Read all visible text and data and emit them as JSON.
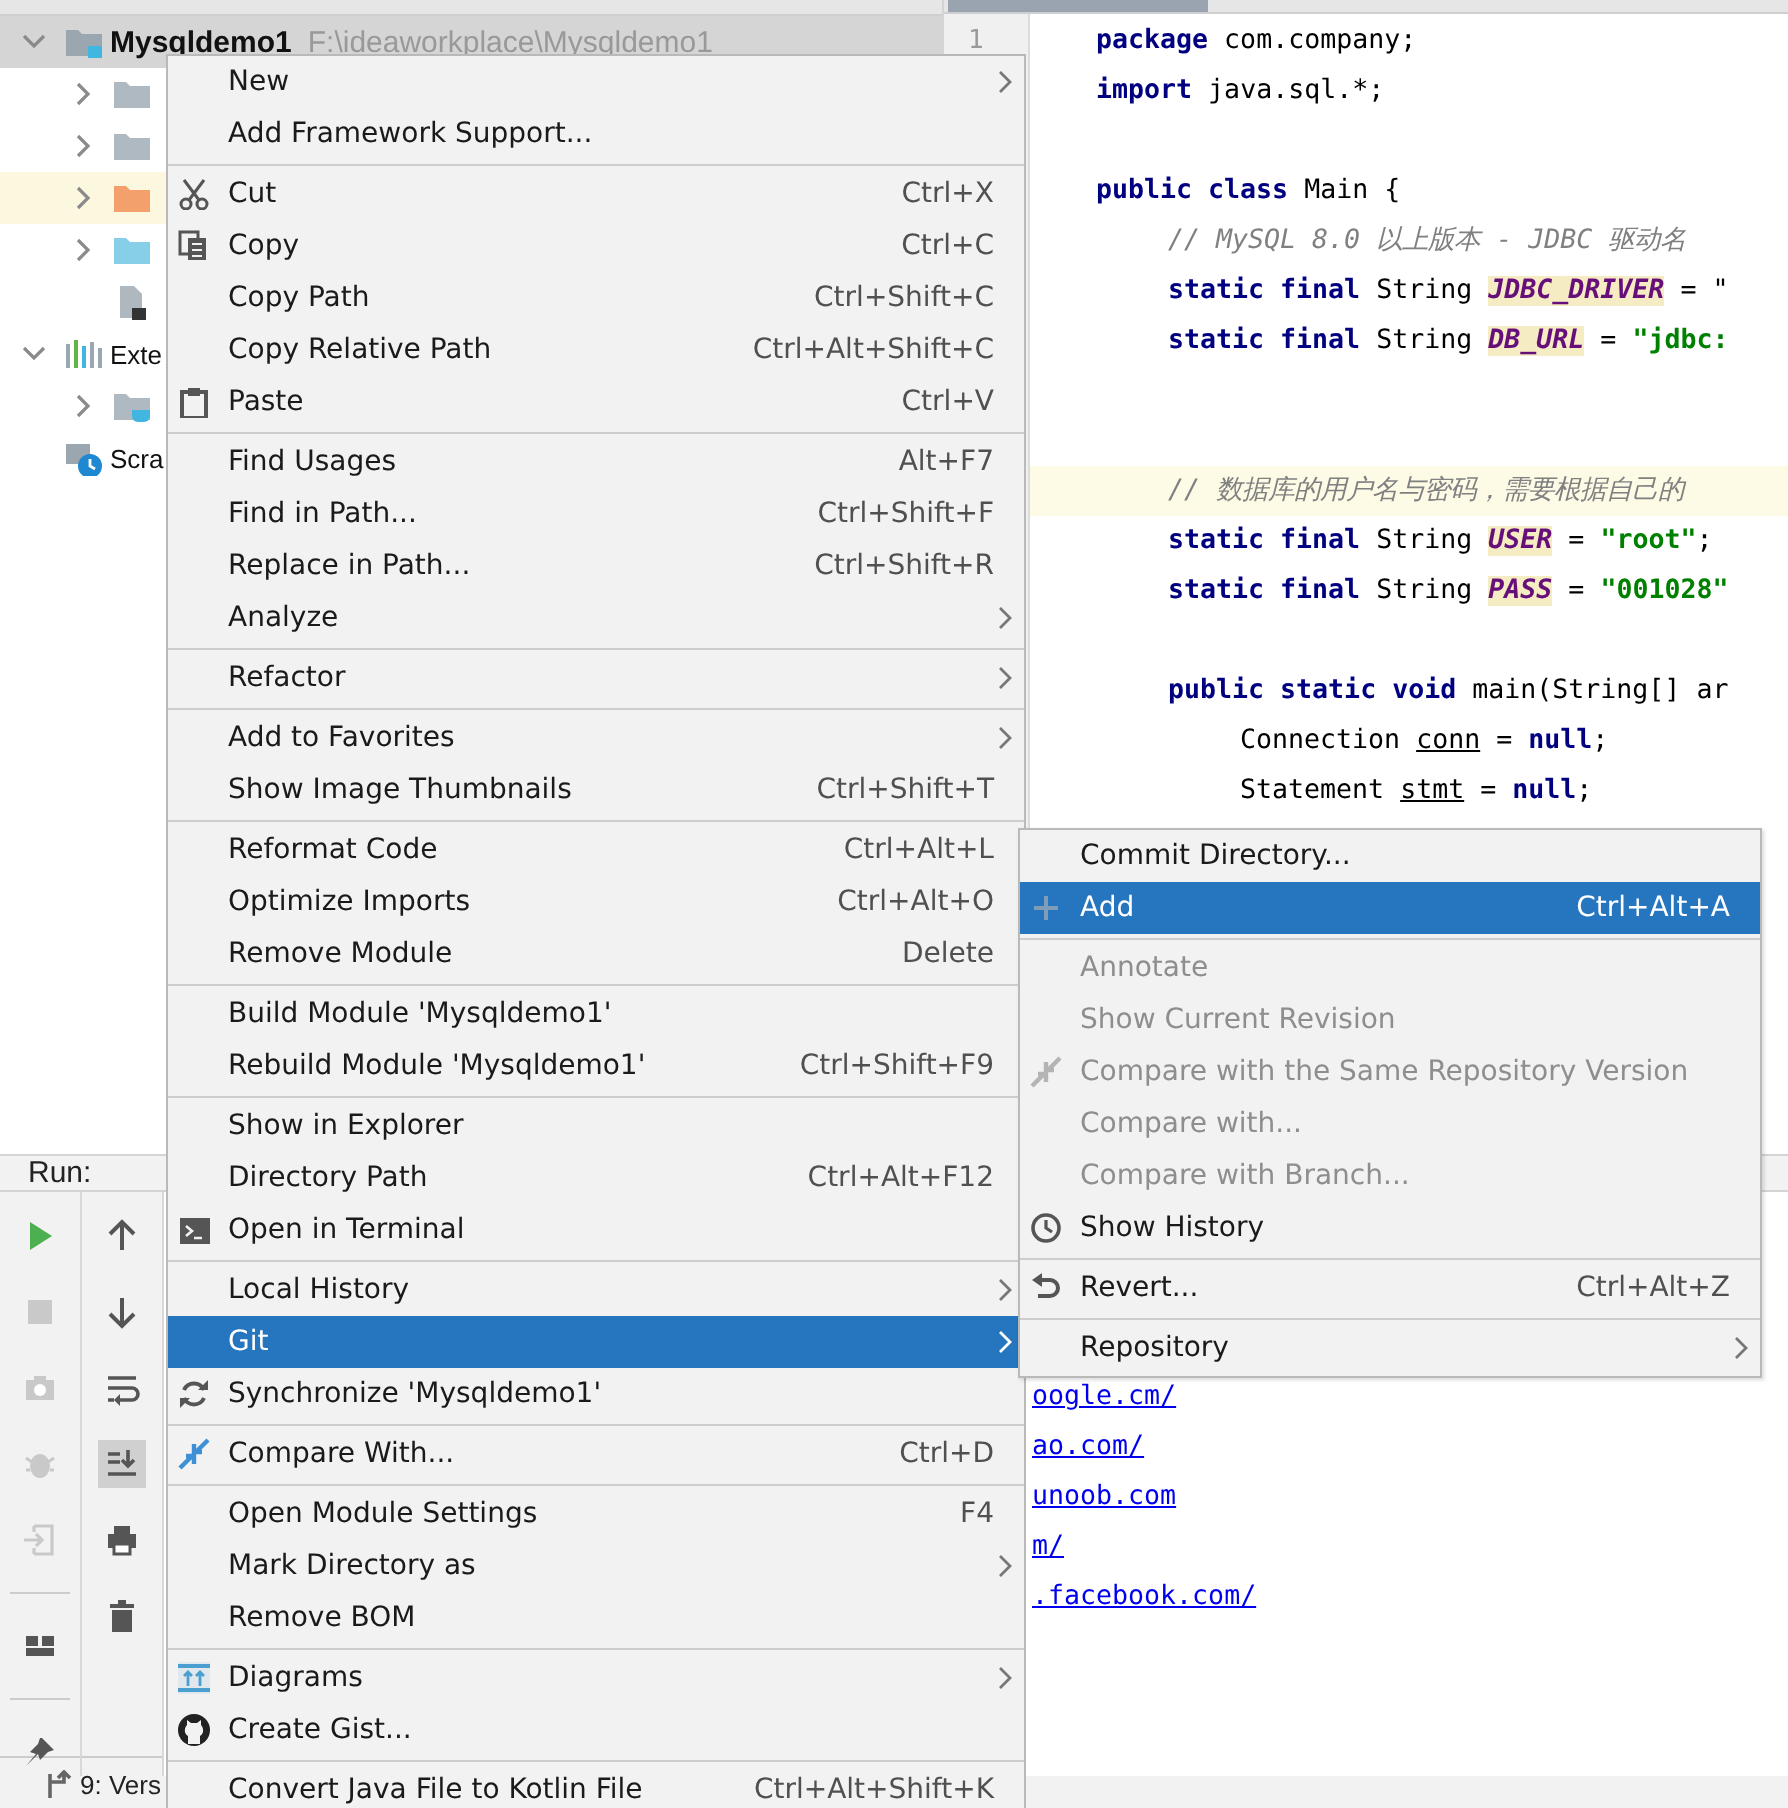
{
  "project_tree": [
    {
      "label": "Mysqldemo1",
      "path": "F:\\ideaworkplace\\Mysqldemo1",
      "kind": "module",
      "expanded": true,
      "selected": true,
      "highlighted": false,
      "children": [
        {
          "kind": "folder",
          "color": "#afb9c1",
          "expanded": false,
          "selected": false,
          "highlighted": false
        },
        {
          "kind": "folder",
          "color": "#afb9c1",
          "expanded": false,
          "selected": false,
          "highlighted": false
        },
        {
          "kind": "folder",
          "color": "#f4a06c",
          "expanded": false,
          "selected": false,
          "highlighted": true
        },
        {
          "kind": "folder",
          "color": "#87cfe8",
          "expanded": false,
          "selected": false,
          "highlighted": false
        },
        {
          "kind": "file",
          "selected": false,
          "highlighted": false
        }
      ]
    },
    {
      "label": "Exte",
      "kind": "libraries",
      "expanded": true,
      "selected": false,
      "highlighted": false,
      "children": [
        {
          "kind": "jdk",
          "expanded": false,
          "selected": false,
          "highlighted": false
        }
      ]
    },
    {
      "label": "Scra",
      "kind": "scratches",
      "selected": false,
      "highlighted": false
    }
  ],
  "editor": {
    "line_number": "1",
    "lines": [
      {
        "kind": "top",
        "current": false,
        "tokens": [
          {
            "kind": "kw",
            "text": "package"
          },
          {
            "kind": "plain",
            "text": " com.company;"
          }
        ]
      },
      {
        "kind": "top",
        "current": false,
        "tokens": [
          {
            "kind": "kw",
            "text": "import"
          },
          {
            "kind": "plain",
            "text": " java.sql.*;"
          }
        ]
      },
      {
        "kind": "blank",
        "current": false
      },
      {
        "kind": "top",
        "current": false,
        "tokens": [
          {
            "kind": "kw",
            "text": "public class"
          },
          {
            "kind": "plain",
            "text": " Main {"
          }
        ]
      },
      {
        "kind": "member",
        "current": false,
        "tokens": [
          {
            "kind": "comment",
            "text": "// MySQL 8.0 以上版本 - JDBC 驱动名"
          }
        ]
      },
      {
        "kind": "member",
        "current": false,
        "tokens": [
          {
            "kind": "kw",
            "text": "static final"
          },
          {
            "kind": "plain",
            "text": " String "
          },
          {
            "kind": "field",
            "text": "JDBC_DRIVER"
          },
          {
            "kind": "plain",
            "text": " = \""
          }
        ]
      },
      {
        "kind": "member",
        "current": false,
        "tokens": [
          {
            "kind": "kw",
            "text": "static final"
          },
          {
            "kind": "plain",
            "text": " String "
          },
          {
            "kind": "field",
            "text": "DB_URL"
          },
          {
            "kind": "plain",
            "text": " = "
          },
          {
            "kind": "string",
            "text": "\"jdbc:"
          }
        ]
      },
      {
        "kind": "blank",
        "current": false
      },
      {
        "kind": "blank",
        "current": false
      },
      {
        "kind": "member",
        "current": true,
        "tokens": [
          {
            "kind": "comment",
            "text": "// 数据库的用户名与密码，需要根据自己的"
          }
        ]
      },
      {
        "kind": "member",
        "current": false,
        "tokens": [
          {
            "kind": "kw",
            "text": "static final"
          },
          {
            "kind": "plain",
            "text": " String "
          },
          {
            "kind": "field",
            "text": "USER"
          },
          {
            "kind": "plain",
            "text": " = "
          },
          {
            "kind": "string",
            "text": "\"root\""
          },
          {
            "kind": "plain",
            "text": ";"
          }
        ]
      },
      {
        "kind": "member",
        "current": false,
        "tokens": [
          {
            "kind": "kw",
            "text": "static final"
          },
          {
            "kind": "plain",
            "text": " String "
          },
          {
            "kind": "field",
            "text": "PASS"
          },
          {
            "kind": "plain",
            "text": " = "
          },
          {
            "kind": "string",
            "text": "\"001028\""
          }
        ]
      },
      {
        "kind": "blank",
        "current": false
      },
      {
        "kind": "member",
        "current": false,
        "tokens": [
          {
            "kind": "kw",
            "text": "public static void"
          },
          {
            "kind": "plain",
            "text": " main(String[] ar"
          }
        ]
      },
      {
        "kind": "body",
        "current": false,
        "tokens": [
          {
            "kind": "plain",
            "text": "Connection "
          },
          {
            "kind": "var",
            "text": "conn"
          },
          {
            "kind": "plain",
            "text": " = "
          },
          {
            "kind": "kw",
            "text": "null"
          },
          {
            "kind": "plain",
            "text": ";"
          }
        ]
      },
      {
        "kind": "body",
        "current": false,
        "tokens": [
          {
            "kind": "plain",
            "text": "Statement "
          },
          {
            "kind": "var",
            "text": "stmt"
          },
          {
            "kind": "plain",
            "text": " = "
          },
          {
            "kind": "kw",
            "text": "null"
          },
          {
            "kind": "plain",
            "text": ";"
          }
        ]
      }
    ]
  },
  "run_panel": {
    "title": "Run:",
    "scroll_to_end": true,
    "console": [
      {
        "kind": "link",
        "text": "oogle.cm/"
      },
      {
        "kind": "link",
        "text": "ao.com/"
      },
      {
        "kind": "link",
        "text": "unoob.com"
      },
      {
        "kind": "link",
        "text": "m/"
      },
      {
        "kind": "link",
        "text": ".facebook.com/"
      }
    ]
  },
  "status_bar": {
    "tool_window": "9: Vers"
  },
  "context_menu": {
    "sections": [
      [
        {
          "label": "New",
          "submenu": true,
          "selected": false
        },
        {
          "label": "Add Framework Support...",
          "submenu": false,
          "selected": false
        }
      ],
      [
        {
          "label": "Cut",
          "shortcut": "Ctrl+X",
          "submenu": false,
          "selected": false
        },
        {
          "label": "Copy",
          "shortcut": "Ctrl+C",
          "submenu": false,
          "selected": false
        },
        {
          "label": "Copy Path",
          "shortcut": "Ctrl+Shift+C",
          "submenu": false,
          "selected": false
        },
        {
          "label": "Copy Relative Path",
          "shortcut": "Ctrl+Alt+Shift+C",
          "submenu": false,
          "selected": false
        },
        {
          "label": "Paste",
          "shortcut": "Ctrl+V",
          "submenu": false,
          "selected": false
        }
      ],
      [
        {
          "label": "Find Usages",
          "shortcut": "Alt+F7",
          "submenu": false,
          "selected": false
        },
        {
          "label": "Find in Path...",
          "shortcut": "Ctrl+Shift+F",
          "submenu": false,
          "selected": false
        },
        {
          "label": "Replace in Path...",
          "shortcut": "Ctrl+Shift+R",
          "submenu": false,
          "selected": false
        },
        {
          "label": "Analyze",
          "submenu": true,
          "selected": false
        }
      ],
      [
        {
          "label": "Refactor",
          "submenu": true,
          "selected": false
        }
      ],
      [
        {
          "label": "Add to Favorites",
          "submenu": true,
          "selected": false
        },
        {
          "label": "Show Image Thumbnails",
          "shortcut": "Ctrl+Shift+T",
          "submenu": false,
          "selected": false
        }
      ],
      [
        {
          "label": "Reformat Code",
          "shortcut": "Ctrl+Alt+L",
          "submenu": false,
          "selected": false
        },
        {
          "label": "Optimize Imports",
          "shortcut": "Ctrl+Alt+O",
          "submenu": false,
          "selected": false
        },
        {
          "label": "Remove Module",
          "shortcut": "Delete",
          "submenu": false,
          "selected": false
        }
      ],
      [
        {
          "label": "Build Module 'Mysqldemo1'",
          "submenu": false,
          "selected": false
        },
        {
          "label": "Rebuild Module 'Mysqldemo1'",
          "shortcut": "Ctrl+Shift+F9",
          "submenu": false,
          "selected": false
        }
      ],
      [
        {
          "label": "Show in Explorer",
          "submenu": false,
          "selected": false
        },
        {
          "label": "Directory Path",
          "shortcut": "Ctrl+Alt+F12",
          "submenu": false,
          "selected": false
        },
        {
          "label": "Open in Terminal",
          "submenu": false,
          "selected": false
        }
      ],
      [
        {
          "label": "Local History",
          "submenu": true,
          "selected": false
        },
        {
          "label": "Git",
          "submenu": true,
          "selected": true
        },
        {
          "label": "Synchronize 'Mysqldemo1'",
          "submenu": false,
          "selected": false
        }
      ],
      [
        {
          "label": "Compare With...",
          "shortcut": "Ctrl+D",
          "submenu": false,
          "selected": false
        }
      ],
      [
        {
          "label": "Open Module Settings",
          "shortcut": "F4",
          "submenu": false,
          "selected": false
        },
        {
          "label": "Mark Directory as",
          "submenu": true,
          "selected": false
        },
        {
          "label": "Remove BOM",
          "submenu": false,
          "selected": false
        }
      ],
      [
        {
          "label": "Diagrams",
          "submenu": true,
          "selected": false
        },
        {
          "label": "Create Gist...",
          "submenu": false,
          "selected": false
        }
      ],
      [
        {
          "label": "Convert Java File to Kotlin File",
          "shortcut": "Ctrl+Alt+Shift+K",
          "submenu": false,
          "selected": false
        }
      ]
    ]
  },
  "git_submenu": {
    "sections": [
      [
        {
          "label": "Commit Directory...",
          "submenu": false,
          "selected": false,
          "disabled": false
        },
        {
          "label": "Add",
          "shortcut": "Ctrl+Alt+A",
          "submenu": false,
          "selected": true,
          "disabled": false
        }
      ],
      [
        {
          "label": "Annotate",
          "submenu": false,
          "selected": false,
          "disabled": true
        },
        {
          "label": "Show Current Revision",
          "submenu": false,
          "selected": false,
          "disabled": true
        },
        {
          "label": "Compare with the Same Repository Version",
          "submenu": false,
          "selected": false,
          "disabled": true
        },
        {
          "label": "Compare with...",
          "submenu": false,
          "selected": false,
          "disabled": true
        },
        {
          "label": "Compare with Branch...",
          "submenu": false,
          "selected": false,
          "disabled": true
        },
        {
          "label": "Show History",
          "submenu": false,
          "selected": false,
          "disabled": false
        }
      ],
      [
        {
          "label": "Revert...",
          "shortcut": "Ctrl+Alt+Z",
          "submenu": false,
          "selected": false,
          "disabled": false
        }
      ],
      [
        {
          "label": "Repository",
          "submenu": true,
          "selected": false,
          "disabled": false
        }
      ]
    ]
  }
}
